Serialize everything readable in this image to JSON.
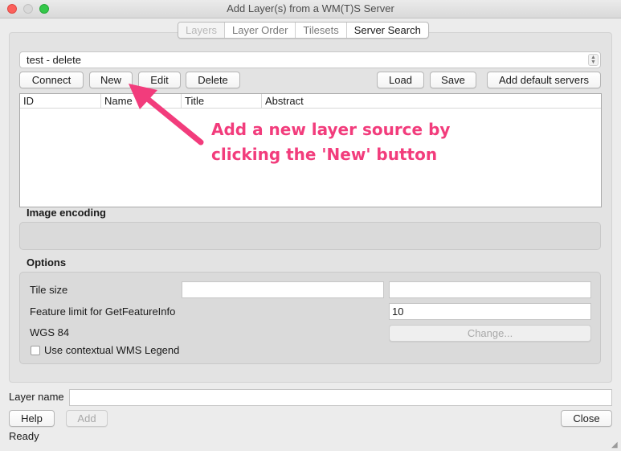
{
  "window": {
    "title": "Add Layer(s) from a WM(T)S Server"
  },
  "tabs": [
    {
      "label": "Layers",
      "state": "disabled"
    },
    {
      "label": "Layer Order",
      "state": "muted"
    },
    {
      "label": "Tilesets",
      "state": "muted"
    },
    {
      "label": "Server Search",
      "state": "normal"
    }
  ],
  "connection": {
    "selected": "test - delete"
  },
  "buttons": {
    "connect": "Connect",
    "new": "New",
    "edit": "Edit",
    "delete": "Delete",
    "load": "Load",
    "save": "Save",
    "add_default": "Add default servers"
  },
  "layers_table": {
    "columns": [
      "ID",
      "Name",
      "Title",
      "Abstract"
    ],
    "rows": []
  },
  "annotation": {
    "line1": "Add a new layer source by",
    "line2": "clicking the 'New' button",
    "color": "#f23c7c"
  },
  "image_encoding": {
    "title": "Image encoding"
  },
  "options": {
    "title": "Options",
    "tile_size_label": "Tile size",
    "tile_width": "",
    "tile_height": "",
    "feature_limit_label": "Feature limit for GetFeatureInfo",
    "feature_limit": "10",
    "crs_label": "WGS 84",
    "change_button": "Change...",
    "contextual_legend_label": "Use contextual WMS Legend",
    "contextual_legend_checked": false
  },
  "layer_name": {
    "label": "Layer name",
    "value": ""
  },
  "footer": {
    "help": "Help",
    "add": "Add",
    "close": "Close",
    "status": "Ready"
  }
}
